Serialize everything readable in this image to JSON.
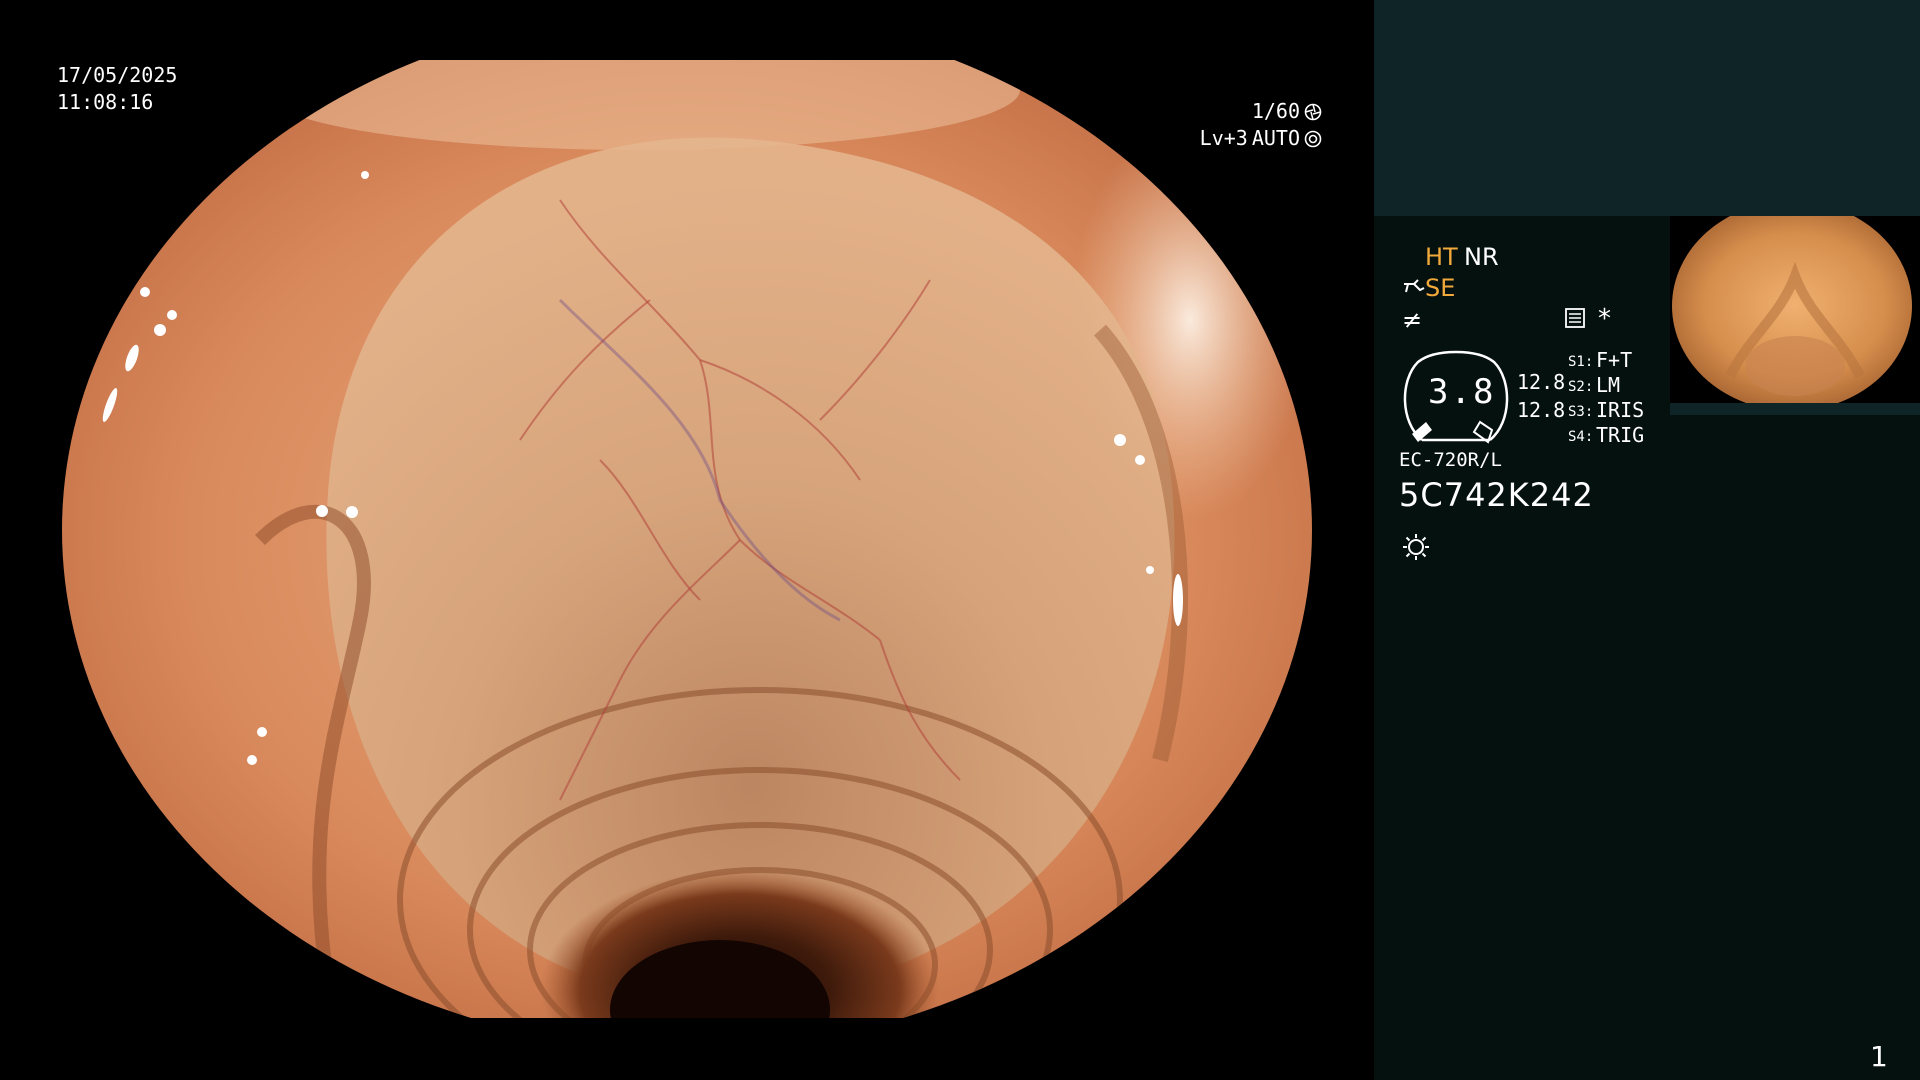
{
  "osd": {
    "date": "17/05/2025",
    "time": "11:08:16",
    "shutter": "1/60",
    "level": "Lv+3",
    "iris_mode": "AUTO"
  },
  "panel": {
    "ht": "HT",
    "nr": "NR",
    "se": "SE",
    "f_symbol": "≠",
    "star": "*",
    "gauge_value": "3.8",
    "value_a": "12.8",
    "value_b": "12.8",
    "switches": [
      {
        "key": "S1:",
        "value": "F+T"
      },
      {
        "key": "S2:",
        "value": "LM"
      },
      {
        "key": "S3:",
        "value": "IRIS"
      },
      {
        "key": "S4:",
        "value": "TRIG"
      }
    ],
    "scope_model": "EC-720R/L",
    "serial": "5C742K242",
    "page_number": "1"
  },
  "icons": {
    "shutter": "aperture-icon",
    "iris": "iris-icon",
    "se": "scope-se-icon",
    "memo": "memory-card-icon",
    "light": "light-sun-icon"
  },
  "colors": {
    "panel_bg": "#05110f",
    "panel_top_bg": "#0e2426",
    "accent_orange": "#f2a93b",
    "text": "#ffffff"
  }
}
